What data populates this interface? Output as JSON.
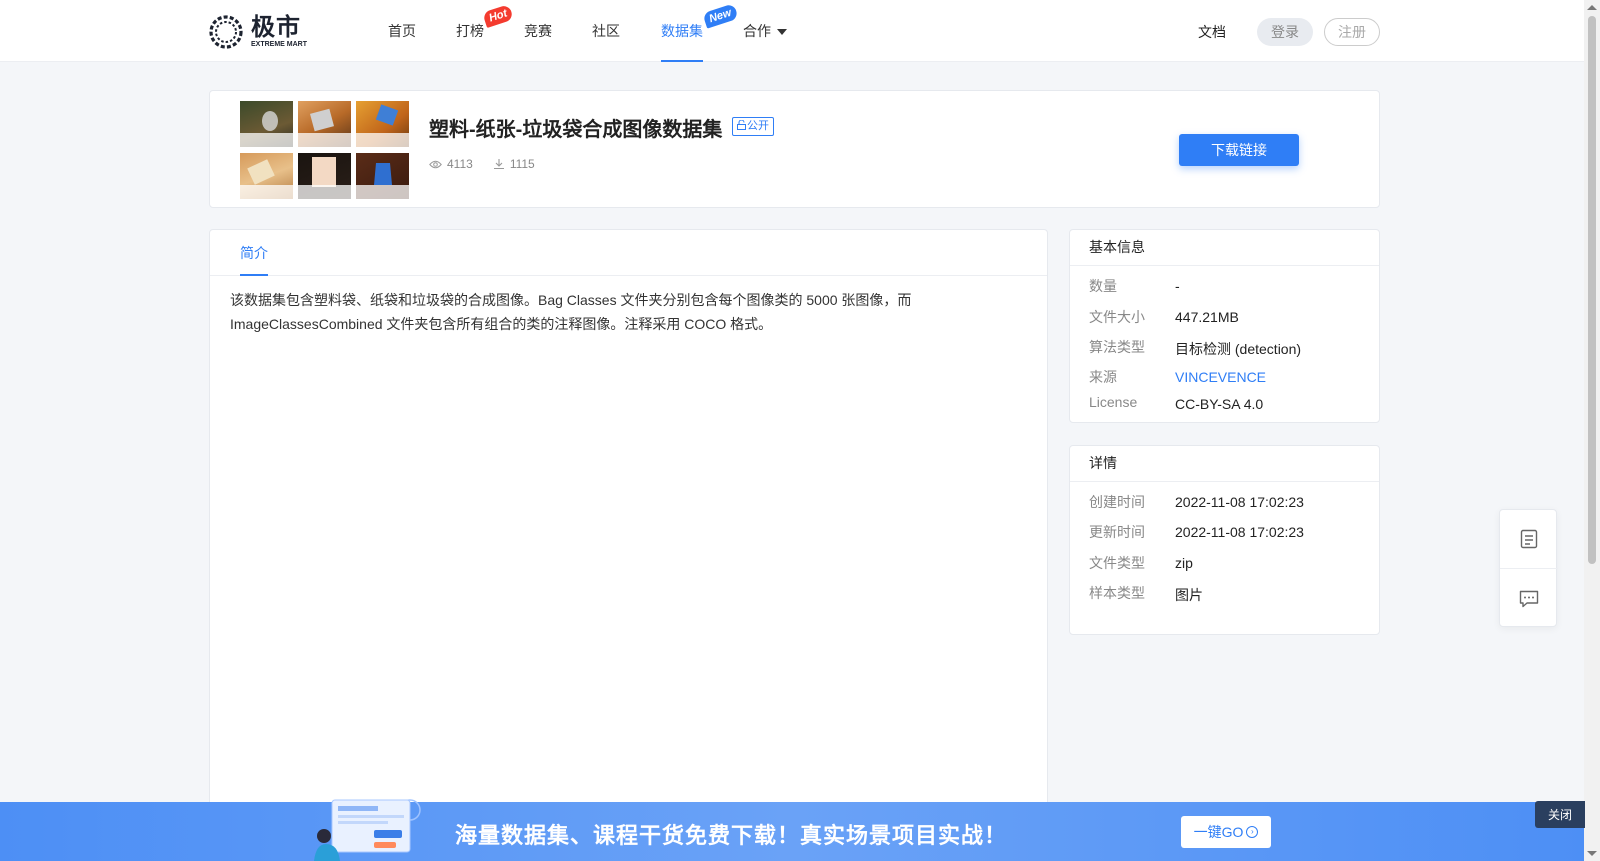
{
  "header": {
    "logo_cn": "极市",
    "logo_en": "EXTREME MART",
    "nav": [
      {
        "label": "首页"
      },
      {
        "label": "打榜",
        "badge": "Hot"
      },
      {
        "label": "竞赛"
      },
      {
        "label": "社区"
      },
      {
        "label": "数据集",
        "badge": "New",
        "active": true
      },
      {
        "label": "合作",
        "dropdown": true
      }
    ],
    "docs": "文档",
    "login": "登录",
    "register": "注册"
  },
  "dataset": {
    "title": "塑料-纸张-垃圾袋合成图像数据集",
    "visibility": "公开",
    "views": "4113",
    "downloads": "1115",
    "download_button": "下载链接"
  },
  "intro": {
    "tab": "简介",
    "text": "该数据集包含塑料袋、纸袋和垃圾袋的合成图像。Bag Classes 文件夹分别包含每个图像类的 5000 张图像，而 ImageClassesCombined 文件夹包含所有组合的类的注释图像。注释采用 COCO 格式。"
  },
  "basic_info": {
    "title": "基本信息",
    "rows": [
      {
        "key": "数量",
        "value": "-"
      },
      {
        "key": "文件大小",
        "value": "447.21MB"
      },
      {
        "key": "算法类型",
        "value": "目标检测 (detection)"
      },
      {
        "key": "来源",
        "value": "VINCEVENCE"
      },
      {
        "key": "License",
        "value": "CC-BY-SA 4.0"
      }
    ]
  },
  "details": {
    "title": "详情",
    "rows": [
      {
        "key": "创建时间",
        "value": "2022-11-08 17:02:23"
      },
      {
        "key": "更新时间",
        "value": "2022-11-08 17:02:23"
      },
      {
        "key": "文件类型",
        "value": "zip"
      },
      {
        "key": "样本类型",
        "value": "图片"
      }
    ]
  },
  "banner": {
    "text": "海量数据集、课程干货免费下载！真实场景项目实战！",
    "go_button": "一键GO",
    "close": "关闭"
  },
  "colors": {
    "accent": "#2f7ef6",
    "hot_badge": "#f43b2f",
    "banner": "#4d8ff5"
  }
}
